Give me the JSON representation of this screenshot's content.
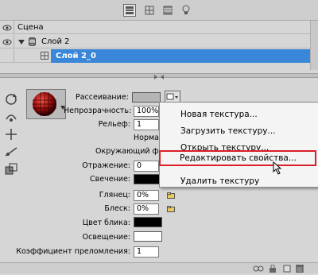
{
  "toolbar": {
    "icons": [
      "layers-icon",
      "grid-icon",
      "table-icon",
      "bulb-icon"
    ]
  },
  "layers": {
    "scene_label": "Сцена",
    "layer_label": "Слой 2",
    "sublayer_label": "Слой 2_0"
  },
  "props": {
    "diffuse_label": "Рассеивание:",
    "opacity_label": "Непрозрачность:",
    "opacity_value": "100%",
    "relief_label": "Рельеф:",
    "relief_value": "1",
    "normal_label": "Нормали",
    "environment_label": "Окружающий фо",
    "reflection_label": "Отражение:",
    "reflection_value": "0",
    "glow_label": "Свечение:",
    "gloss_label": "Глянец:",
    "gloss_value": "0%",
    "shine_label": "Блеск:",
    "shine_value": "0%",
    "specular_label": "Цвет блика:",
    "illumination_label": "Освещение:",
    "refraction_label": "Коэффициент преломления:",
    "refraction_value": "1"
  },
  "context_menu": {
    "items": [
      "Новая текстура...",
      "Загрузить текстуру...",
      "Открыть текстуру...",
      "Редактировать свойства...",
      "Удалить текстуру"
    ],
    "highlighted_index": 3
  },
  "colors": {
    "selection": "#3a86d9",
    "highlight_border": "#d8202a"
  }
}
